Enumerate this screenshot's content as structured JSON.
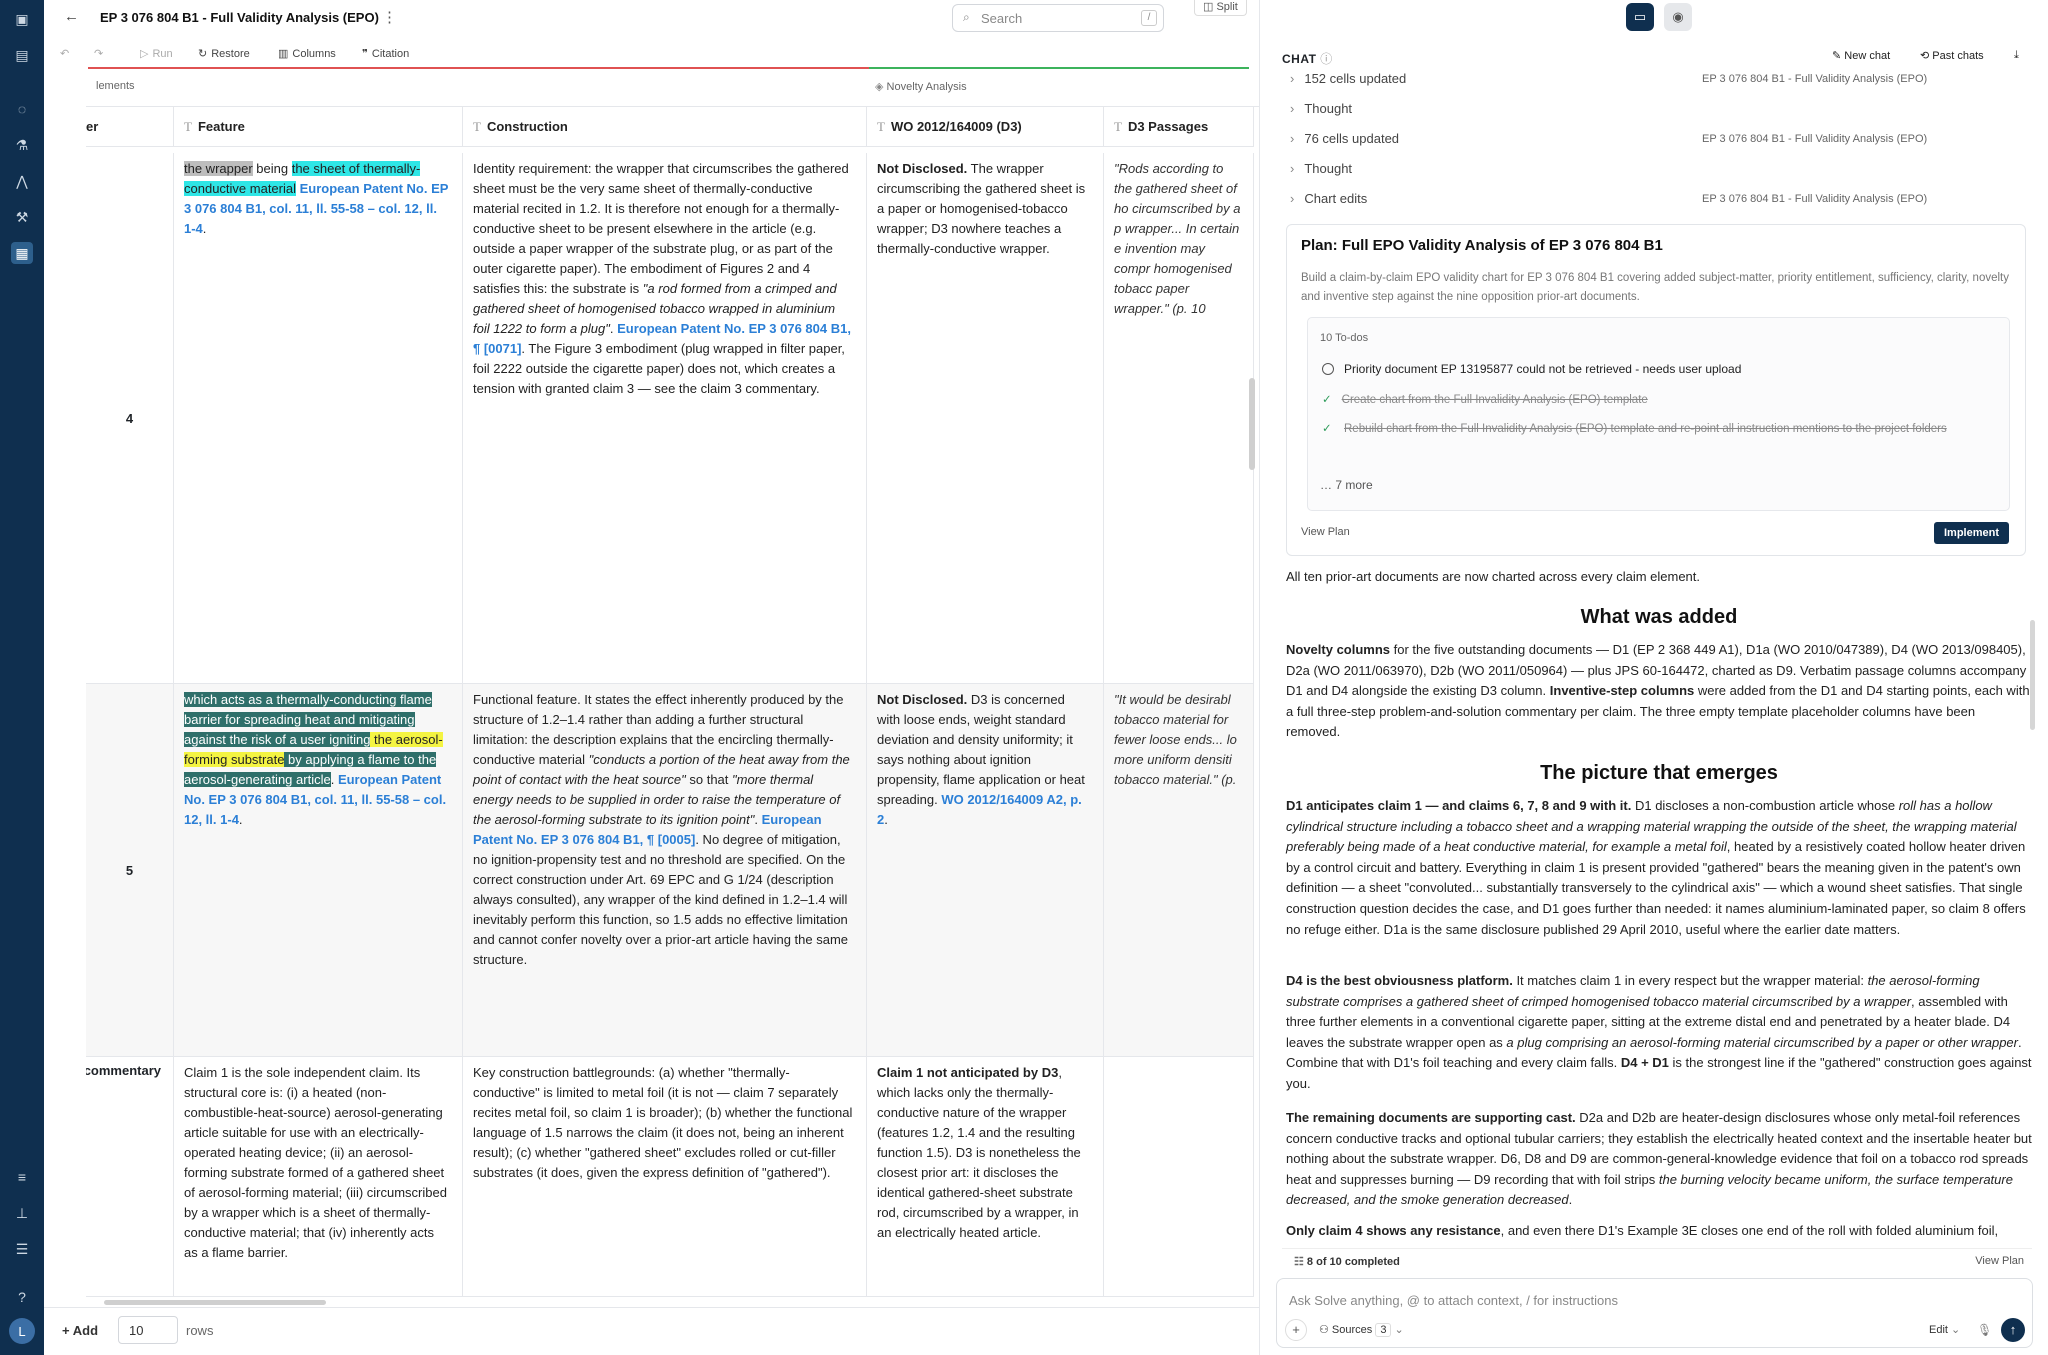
{
  "app": {
    "doc_title": "EP 3 076 804 B1 - Full Validity Analysis (EPO)",
    "search_placeholder": "Search",
    "search_shortcut": "/",
    "split_label": "Split",
    "avatar_initial": "L"
  },
  "toolbar": {
    "run": "Run",
    "restore": "Restore",
    "columns": "Columns",
    "citation": "Citation"
  },
  "grid": {
    "group_elements": "lements",
    "group_novelty": "Novelty Analysis",
    "col_number": "er",
    "col_feature": "Feature",
    "col_construction": "Construction",
    "col_wo": "WO 2012/164009 (D3)",
    "col_d3p": "D3 Passages",
    "row4": {
      "num": "4",
      "f_1": "the wrapper",
      "f_2": " being ",
      "f_3": "the sheet of thermally-conductive material",
      "f_ref": "European Patent No. EP 3 076 804 B1, col. 11, ll. 55-58 – col. 12, ll. 1-4",
      "c_1": "Identity requirement: the wrapper that circumscribes the gathered sheet must be the very same sheet of thermally-conductive material recited in 1.2. It is therefore not enough for a thermally-conductive sheet to be present elsewhere in the article (e.g. outside a paper wrapper of the substrate plug, or as part of the outer cigarette paper). The embodiment of Figures 2 and 4 satisfies this: the substrate is ",
      "c_q": "\"a rod formed from a crimped and gathered sheet of homogenised tobacco wrapped in aluminium foil 1222 to form a plug\"",
      "c_ref": "European Patent No. EP 3 076 804 B1, ¶ [0071]",
      "c_2": ". The Figure 3 embodiment (plug wrapped in filter paper, foil 2222 outside the cigarette paper) does not, which creates a tension with granted claim 3 — see the claim 3 commentary.",
      "w_b": "Not Disclosed.",
      "w_t": " The wrapper circumscribing the gathered sheet is a paper or homogenised-tobacco wrapper; D3 nowhere teaches a thermally-conductive wrapper.",
      "d3": "\"Rods according to the gathered sheet of ho circumscribed by a p wrapper... In certain e invention may compr homogenised tobacc paper wrapper.\" (p. 10"
    },
    "row5": {
      "num": "5",
      "f_1": "which acts as a thermally-conducting flame barrier for spreading heat and mitigating against the risk of a user igniting",
      "f_2": " the aerosol-forming substrate",
      "f_3": " by applying a flame to the aerosol-generating article",
      "f_ref": "European Patent No. EP 3 076 804 B1, col. 11, ll. 55-58 – col. 12, ll. 1-4",
      "c_1": "Functional feature. It states the effect inherently produced by the structure of 1.2–1.4 rather than adding a further structural limitation: the description explains that the encircling thermally-conductive material ",
      "c_q1": "\"conducts a portion of the heat away from the point of contact with the heat source\"",
      "c_2": " so that ",
      "c_q2": "\"more thermal energy needs to be supplied in order to raise the temperature of the aerosol-forming substrate to its ignition point\"",
      "c_ref": "European Patent No. EP 3 076 804 B1, ¶ [0005]",
      "c_3": ". No degree of mitigation, no ignition-propensity test and no threshold are specified. On the correct construction under Art. 69 EPC and G 1/24 (description always consulted), any wrapper of the kind defined in 1.2–1.4 will inevitably perform this function, so 1.5 adds no effective limitation and cannot confer novelty over a prior-art article having the same structure.",
      "w_b": "Not Disclosed.",
      "w_t": " D3 is concerned with loose ends, weight standard deviation and density uniformity; it says nothing about ignition propensity, flame application or heat spreading. ",
      "w_ref": "WO 2012/164009 A2, p. 2",
      "d3": "\"It would be desirabl tobacco material for fewer loose ends... lo more uniform densiti tobacco material.\" (p."
    },
    "row6": {
      "num": "commentary",
      "f": "Claim 1 is the sole independent claim. Its structural core is: (i) a heated (non-combustible-heat-source) aerosol-generating article suitable for use with an electrically-operated heating device; (ii) an aerosol-forming substrate formed of a gathered sheet of aerosol-forming material; (iii) circumscribed by a wrapper which is a sheet of thermally-conductive material; that (iv) inherently acts as a flame barrier.",
      "c": "Key construction battlegrounds: (a) whether \"thermally-conductive\" is limited to metal foil (it is not — claim 7 separately recites metal foil, so claim 1 is broader); (b) whether the functional language of 1.5 narrows the claim (it does not, being an inherent result); (c) whether \"gathered sheet\" excludes rolled or cut-filler substrates (it does, given the express definition of \"gathered\").",
      "w_b": "Claim 1 not anticipated by D3",
      "w_t": ", which lacks only the thermally-conductive nature of the wrapper (features 1.2, 1.4 and the resulting function 1.5). D3 is nonetheless the closest prior art: it discloses the identical gathered-sheet substrate rod, circumscribed by a wrapper, in an electrically heated article."
    }
  },
  "footer": {
    "add": "Add",
    "rows_value": "10",
    "rows_label": "rows"
  },
  "chat": {
    "header": "CHAT",
    "new_chat": "New chat",
    "past_chats": "Past chats",
    "steps": [
      {
        "label": "152 cells updated",
        "ref": "EP 3 076 804 B1 - Full Validity Analysis (EPO)"
      },
      {
        "label": "Thought",
        "ref": ""
      },
      {
        "label": "76 cells updated",
        "ref": "EP 3 076 804 B1 - Full Validity Analysis (EPO)"
      },
      {
        "label": "Thought",
        "ref": ""
      },
      {
        "label": "Chart edits",
        "ref": "EP 3 076 804 B1 - Full Validity Analysis (EPO)"
      }
    ],
    "plan": {
      "title": "Plan: Full EPO Validity Analysis of EP 3 076 804 B1",
      "desc": "Build a claim-by-claim EPO validity chart for EP 3 076 804 B1 covering added subject-matter, priority entitlement, sufficiency, clarity, novelty and inventive step against the nine opposition prior-art documents.",
      "todos_count": "10 To-dos",
      "todo1": "Priority document EP 13195877 could not be retrieved - needs user upload",
      "todo2": "Create chart from the Full Invalidity Analysis (EPO) template",
      "todo3": "Rebuild chart from the Full Invalidity Analysis (EPO) template and re-point all instruction mentions to the project folders",
      "more": "7 more",
      "view_plan": "View Plan",
      "implement": "Implement"
    },
    "intro": "All ten prior-art documents are now charted across every claim element.",
    "h_added": "What was added",
    "p_added_b1": "Novelty columns",
    "p_added_1": " for the five outstanding documents — D1 (EP 2 368 449 A1), D1a (WO 2010/047389), D4 (WO 2013/098405), D2a (WO 2011/063970), D2b (WO 2011/050964) — plus JPS 60-164472, charted as D9. Verbatim passage columns accompany D1 and D4 alongside the existing D3 column. ",
    "p_added_b2": "Inventive-step columns",
    "p_added_2": " were added from the D1 and D4 starting points, each with a full three-step problem-and-solution commentary per claim. The three empty template placeholder columns have been removed.",
    "h_picture": "The picture that emerges",
    "p1_b": "D1 anticipates claim 1 — and claims 6, 7, 8 and 9 with it.",
    "p1_1": " D1 discloses a non-combustion article whose ",
    "p1_i": "roll has a hollow cylindrical structure including a tobacco sheet and a wrapping material wrapping the outside of the sheet, the wrapping material preferably being made of a heat conductive material, for example a metal foil",
    "p1_2": ", heated by a resistively coated hollow heater driven by a control circuit and battery. Everything in claim 1 is present provided \"gathered\" bears the meaning given in the patent's own definition — a sheet \"convoluted... substantially transversely to the cylindrical axis\" — which a wound sheet satisfies. That single construction question decides the case, and D1 goes further than needed: it names aluminium-laminated paper, so claim 8 offers no refuge either. D1a is the same disclosure published 29 April 2010, useful where the earlier date matters.",
    "p2_b": "D4 is the best obviousness platform.",
    "p2_1": " It matches claim 1 in every respect but the wrapper material: ",
    "p2_i1": "the aerosol-forming substrate comprises a gathered sheet of crimped homogenised tobacco material circumscribed by a wrapper",
    "p2_2": ", assembled with three further elements in a conventional cigarette paper, sitting at the extreme distal end and penetrated by a heater blade. D4 leaves the substrate wrapper open as ",
    "p2_i2": "a plug comprising an aerosol-forming material circumscribed by a paper or other wrapper",
    "p2_3": ". Combine that with D1's foil teaching and every claim falls. ",
    "p2_b2": "D4 + D1",
    "p2_4": " is the strongest line if the \"gathered\" construction goes against you.",
    "p3_b": "The remaining documents are supporting cast.",
    "p3_1": " D2a and D2b are heater-design disclosures whose only metal-foil references concern conductive tracks and optional tubular carriers; they establish the electrically heated context and the insertable heater but nothing about the substrate wrapper. D6, D8 and D9 are common-general-knowledge evidence that foil on a tobacco rod spreads heat and suppresses burning — D9 recording that with foil strips ",
    "p3_i": "the burning velocity became uniform, the surface temperature decreased, and the smoke generation decreased",
    "p3_2": ".",
    "p4_b": "Only claim 4 shows any resistance",
    "p4_1": ", and even there D1's Example 3E closes one end of the roll with folded aluminium foil,",
    "progress": "8 of 10 completed",
    "progress_view": "View Plan",
    "input_placeholder": "Ask Solve anything, @ to attach context, / for instructions",
    "sources": "Sources",
    "sources_count": "3",
    "mode": "Edit"
  }
}
